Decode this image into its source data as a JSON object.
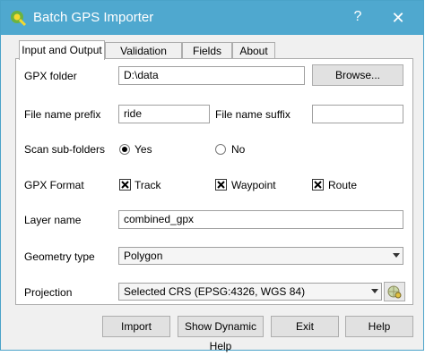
{
  "window": {
    "title": "Batch GPS Importer",
    "help_glyph": "?",
    "close_glyph": "✕"
  },
  "tabs": [
    {
      "label": "Input and Output",
      "active": true
    },
    {
      "label": "Validation",
      "active": false
    },
    {
      "label": "Fields",
      "active": false
    },
    {
      "label": "About",
      "active": false
    }
  ],
  "form": {
    "gpx_folder_label": "GPX folder",
    "gpx_folder_value": "D:\\data",
    "browse_label": "Browse...",
    "prefix_label": "File name prefix",
    "prefix_value": "ride",
    "suffix_label": "File name suffix",
    "suffix_value": "",
    "scan_label": "Scan sub-folders",
    "scan_yes_label": "Yes",
    "scan_no_label": "No",
    "scan_selected": "Yes",
    "gpx_format_label": "GPX Format",
    "track_label": "Track",
    "waypoint_label": "Waypoint",
    "route_label": "Route",
    "layer_name_label": "Layer name",
    "layer_name_value": "combined_gpx",
    "geometry_type_label": "Geometry type",
    "geometry_type_value": "Polygon",
    "projection_label": "Projection",
    "projection_value": "Selected CRS (EPSG:4326, WGS 84)"
  },
  "buttons": {
    "import_label": "Import",
    "dynamic_help_label": "Show Dynamic Help",
    "exit_label": "Exit",
    "help_label": "Help"
  },
  "colors": {
    "titlebar": "#4fa8cf",
    "qgis_green": "#6cb33f",
    "qgis_yellow": "#f5d92e"
  }
}
